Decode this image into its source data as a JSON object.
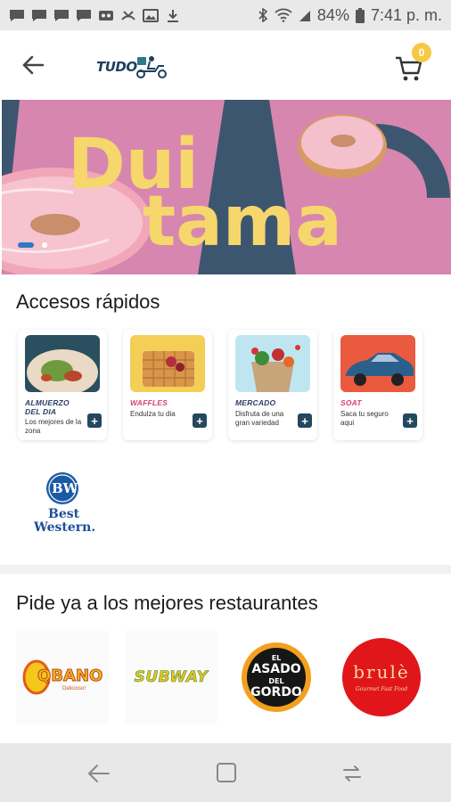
{
  "status_bar": {
    "battery": "84%",
    "time": "7:41 p. m."
  },
  "header": {
    "logo_text": "TUDO",
    "cart_count": "0"
  },
  "banner": {
    "line1": "Dui",
    "line2": "tama",
    "colors": {
      "pink": "#d786b0",
      "navy": "#3c5670",
      "yellow": "#f6d76b"
    }
  },
  "quick_access": {
    "title": "Accesos rápidos",
    "cards": [
      {
        "title": "ALMUERZO DEL DIA",
        "desc": "Los mejores de la zona"
      },
      {
        "title": "WAFFLES",
        "desc": "Endulza tu dia"
      },
      {
        "title": "MERCADO",
        "desc": "Disfruta de una gran variedad"
      },
      {
        "title": "SOAT",
        "desc": "Saca tu seguro aqui"
      }
    ],
    "partner": {
      "line1": "Best",
      "line2": "Western.",
      "badge": "BW"
    }
  },
  "restaurants": {
    "title": "Pide ya a los mejores restaurantes",
    "items": [
      {
        "name": "QBANO",
        "sub": "Delicioso!"
      },
      {
        "name": "SUBWAY"
      },
      {
        "name_lines": [
          "EL",
          "ASADO",
          "DEL",
          "GORDO"
        ]
      },
      {
        "name": "brulè",
        "sub": "Gourmet Fast Food"
      }
    ]
  }
}
